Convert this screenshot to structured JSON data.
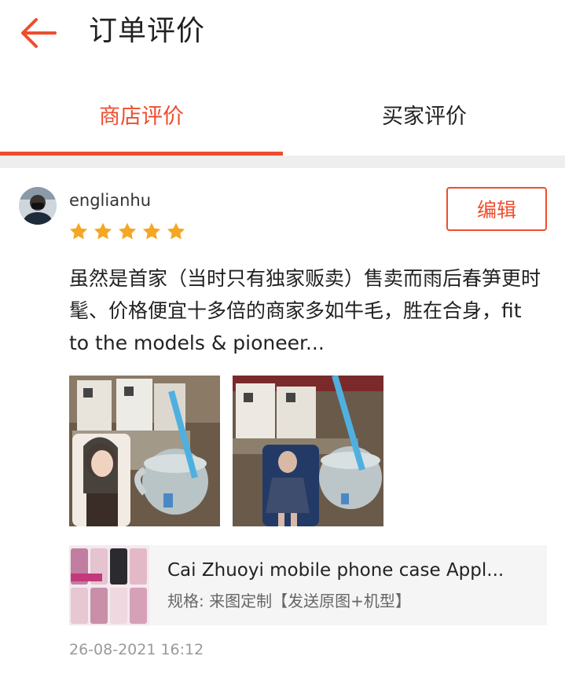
{
  "header": {
    "title": "订单评价",
    "back_icon": "arrow-left-icon",
    "accent_color": "#ee4d2d"
  },
  "tabs": [
    {
      "label": "商店评价",
      "active": true
    },
    {
      "label": "买家评价",
      "active": false
    }
  ],
  "review": {
    "username": "englianhu",
    "rating": 5,
    "rating_max": 5,
    "star_color": "#f5a623",
    "edit_label": "编辑",
    "comment": "虽然是首家（当时只有独家贩卖）售卖而雨后春笋更时髦、价格便宜十多倍的商家多如牛毛，胜在合身，fit to the models & pioneer...",
    "photos": [
      {
        "icon": "review-photo"
      },
      {
        "icon": "review-photo"
      }
    ],
    "product": {
      "name": "Cai Zhuoyi mobile phone case Appl...",
      "variant": "规格: 来图定制【发送原图+机型】"
    },
    "timestamp": "26-08-2021 16:12"
  }
}
